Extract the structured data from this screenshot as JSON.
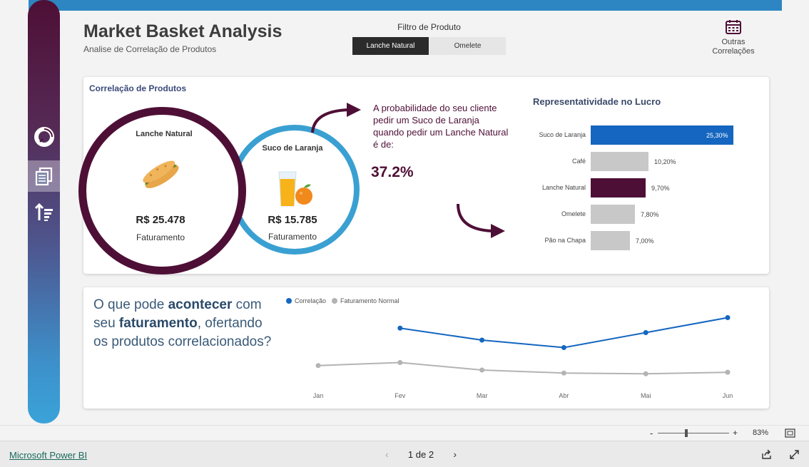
{
  "header": {
    "title": "Market Basket Analysis",
    "subtitle": "Analise de Correlação de Produtos",
    "filter_label": "Filtro de Produto",
    "filters": [
      "Lanche Natural",
      "Omelete"
    ],
    "other_line1": "Outras",
    "other_line2": "Correlações"
  },
  "correlation": {
    "card_title": "Correlação de Produtos",
    "main": {
      "name": "Lanche Natural",
      "value": "R$ 25.478",
      "caption": "Faturamento"
    },
    "related": {
      "name": "Suco de Laranja",
      "value": "R$ 15.785",
      "caption": "Faturamento"
    },
    "prob_text": "A probabilidade do seu cliente pedir um Suco de Laranja quando pedir um Lanche Natural é de:",
    "prob_value": "37.2%"
  },
  "profit": {
    "title": "Representatividade no Lucro",
    "items": [
      {
        "label": "Suco de Laranja",
        "value": 25.3,
        "text": "25,30%",
        "color": "#1466c0"
      },
      {
        "label": "Café",
        "value": 10.2,
        "text": "10,20%",
        "color": "#c8c8c8"
      },
      {
        "label": "Lanche Natural",
        "value": 9.7,
        "text": "9,70%",
        "color": "#4e0f36"
      },
      {
        "label": "Omelete",
        "value": 7.8,
        "text": "7,80%",
        "color": "#c8c8c8"
      },
      {
        "label": "Pão na Chapa",
        "value": 7.0,
        "text": "7,00%",
        "color": "#c8c8c8"
      }
    ]
  },
  "question": {
    "part1": "O que pode ",
    "bold1": "acontecer",
    "part2": " com seu ",
    "bold2": "faturamento",
    "part3": ", ofertando os produtos correlacionados?"
  },
  "chart_data": {
    "type": "line",
    "categories": [
      "Jan",
      "Fev",
      "Mar",
      "Abr",
      "Mai",
      "Jun"
    ],
    "series": [
      {
        "name": "Correlação",
        "color": "#1466c0",
        "values": [
          null,
          88,
          80,
          75,
          85,
          95
        ]
      },
      {
        "name": "Faturamento Normal",
        "color": "#b3b3b3",
        "values": [
          63,
          65,
          60,
          58,
          57.5,
          58.5
        ]
      }
    ],
    "ylim": [
      50,
      100
    ]
  },
  "zoom": {
    "minus": "-",
    "plus": "+",
    "level": "83%"
  },
  "footer": {
    "brand": "Microsoft Power BI",
    "page": "1 de 2"
  }
}
